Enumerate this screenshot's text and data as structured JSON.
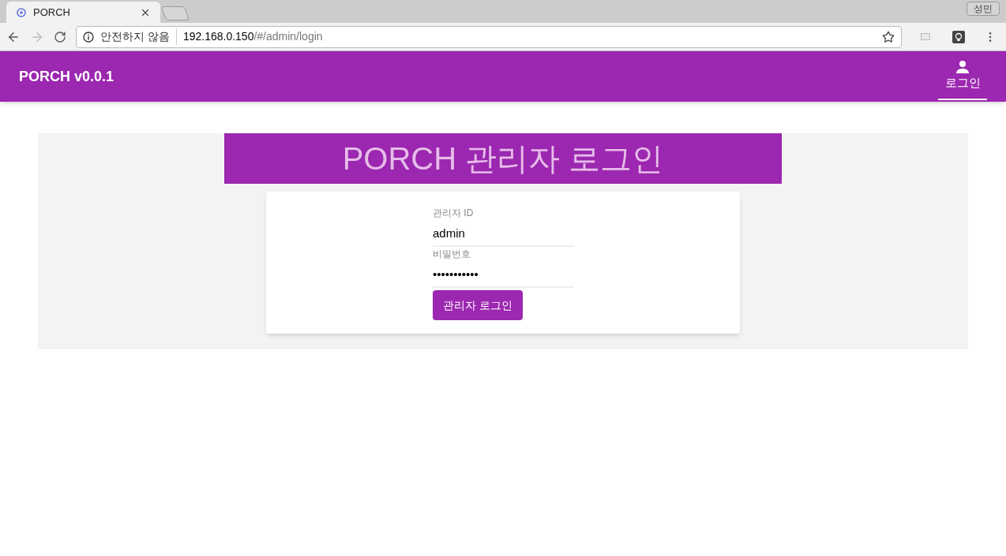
{
  "browser": {
    "tab": {
      "title": "PORCH",
      "selected": true
    },
    "profile": "성민",
    "security": "안전하지 않음",
    "url_host": "192.168.0.150",
    "url_path": "/#/admin/login"
  },
  "app_bar": {
    "title": "PORCH v0.0.1",
    "nav": [
      {
        "label": "로그인",
        "selected": true
      }
    ]
  },
  "login": {
    "heading": "PORCH 관리자 로그인",
    "fields": [
      {
        "label": "관리자 ID",
        "value": "admin"
      },
      {
        "label": "비밀번호",
        "value": "•••••••••••"
      }
    ],
    "button": "관리자 로그인"
  }
}
